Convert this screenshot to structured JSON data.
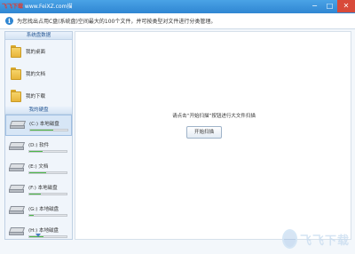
{
  "titlebar": {
    "watermark_red": "飞飞下载",
    "watermark_site": " www.FeiXZ.com",
    "watermark_suffix": "描",
    "minimize": "−",
    "maximize": "□",
    "close": "✕"
  },
  "info": {
    "icon": "i",
    "text": "为您找出占用C盘(系统盘)空间最大的100个文件，并可按类型对文件进行分类管理。"
  },
  "sidebar": {
    "section1": "系统盘数据",
    "folders": [
      {
        "label": "我的桌面",
        "icon": "folder-icon"
      },
      {
        "label": "我的文档",
        "icon": "folder-icon"
      },
      {
        "label": "我的下载",
        "icon": "folder-icon"
      }
    ],
    "section2": "我的硬盘",
    "disks": [
      {
        "label": "(C:) 本地磁盘",
        "usage": 0.62,
        "selected": true
      },
      {
        "label": "(D:) 软件",
        "usage": 0.35
      },
      {
        "label": "(E:) 文档",
        "usage": 0.45
      },
      {
        "label": "(F:) 本地磁盘",
        "usage": 0.3
      },
      {
        "label": "(G:) 本地磁盘",
        "usage": 0.12
      },
      {
        "label": "(H:) 本地磁盘",
        "usage": 0.38
      }
    ]
  },
  "main": {
    "prompt": "请点击“开始扫描”按钮进行大文件扫描",
    "scan_button": "开始扫描"
  },
  "logo": {
    "text": "飞飞下载"
  },
  "colors": {
    "titlebar": "#2f86d2",
    "disk_fill": "#4cb848",
    "accent": "#2a5a96"
  }
}
